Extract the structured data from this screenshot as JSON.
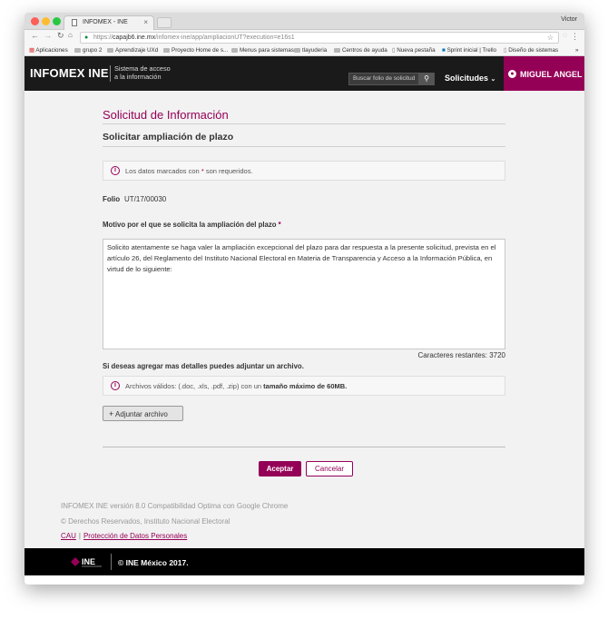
{
  "browser": {
    "tab_title": "INFOMEX - INE",
    "user": "Victor",
    "url_prefix": "https://",
    "url_host": "capajb6.ine.mx",
    "url_path": "/infomex-ine/app/ampliacionUT?execution=e16s1",
    "bookmarks": [
      "Aplicaciones",
      "grupo 2",
      "Aprendizaje UXd",
      "Proyecto Home de s...",
      "Menus para sistemas",
      "tlayuderia",
      "Centros de ayuda",
      "Nueva pestaña",
      "Sprint inicial | Trello",
      "Diseño de sistemas"
    ],
    "bookmarks_more": "»"
  },
  "header": {
    "logo": "INFOMEX INE",
    "subtitle_line1": "Sistema de acceso",
    "subtitle_line2": "a la información",
    "search_placeholder": "Buscar folio de solicitud",
    "solicitudes": "Solicitudes",
    "user_name": "MIGUEL ANGEL"
  },
  "page": {
    "title": "Solicitud de Información",
    "subtitle": "Solicitar ampliación de plazo",
    "required_note_pre": "Los datos marcados con",
    "required_star": "*",
    "required_note_post": "son requeridos.",
    "folio_label": "Folio",
    "folio_value": "UT/17/00030",
    "motivo_label": "Motivo por el que se solicita la ampliación del plazo",
    "motivo_star": "*",
    "motivo_text": "Solicito atentamente se haga valer la ampliación excepcional del plazo para dar respuesta a la presente solicitud, prevista en el artículo 26, del Reglamento del Instituto Nacional Electoral en Materia de Transparencia y Acceso a la Información Pública, en virtud de lo siguiente:",
    "chars_remaining": "Caracteres restantes: 3720",
    "attach_prompt": "Si deseas agregar mas detalles puedes adjuntar un archivo.",
    "attach_info_pre": "Archivos válidos: (.doc, .xls, .pdf, .zip) con un",
    "attach_info_bold": "tamaño máximo de 60MB.",
    "attach_button": "Adjuntar archivo",
    "accept_button": "Aceptar",
    "cancel_button": "Cancelar"
  },
  "footer": {
    "version": "INFOMEX INE versión 8.0 Compatibilidad Optima con Google Chrome",
    "rights": "© Derechos Reservados, Instituto Nacional Electoral",
    "link_cau": "CAU",
    "link_sep": "|",
    "link_privacy": "Protección de Datos Personales",
    "ine_logo": "INE",
    "copyright": "© INE México 2017."
  },
  "colors": {
    "brand": "#950057",
    "header_bg": "#1a1a1a"
  }
}
